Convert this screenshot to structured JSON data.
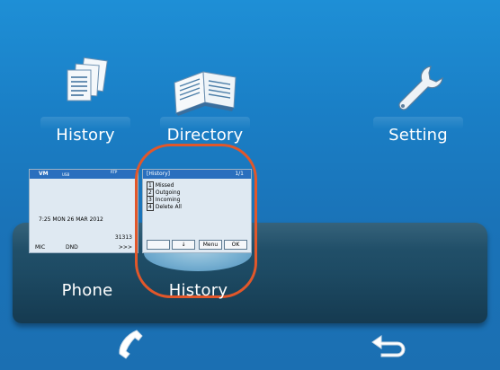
{
  "top_menu": [
    {
      "label": "History",
      "icon": "documents-stack-icon"
    },
    {
      "label": "Directory",
      "icon": "open-book-icon"
    },
    {
      "label": "Setting",
      "icon": "wrench-icon"
    }
  ],
  "dock": {
    "items": [
      {
        "label": "Phone"
      },
      {
        "label": "History"
      }
    ]
  },
  "phone_screen": {
    "status_left": "VM",
    "status_mid": "USB",
    "status_right": "RTP",
    "datetime": "7:25 MON 26 MAR 2012",
    "extension": "31313",
    "soft_keys": [
      "MIC",
      "DND",
      ">>>"
    ]
  },
  "history_screen": {
    "title": "[History]",
    "page": "1/1",
    "items": [
      {
        "num": "1",
        "text": "Missed"
      },
      {
        "num": "2",
        "text": "Outgoing"
      },
      {
        "num": "3",
        "text": "Incoming"
      },
      {
        "num": "4",
        "text": "Delete All"
      }
    ],
    "soft_keys": [
      "",
      "↓",
      "Menu",
      "OK"
    ]
  },
  "bottom_bar": {
    "left_icon": "handset-icon",
    "right_icon": "back-arrow-icon"
  },
  "colors": {
    "background": "#1a7fc6",
    "highlight": "#e2572a",
    "dock": "#1d4a63"
  }
}
